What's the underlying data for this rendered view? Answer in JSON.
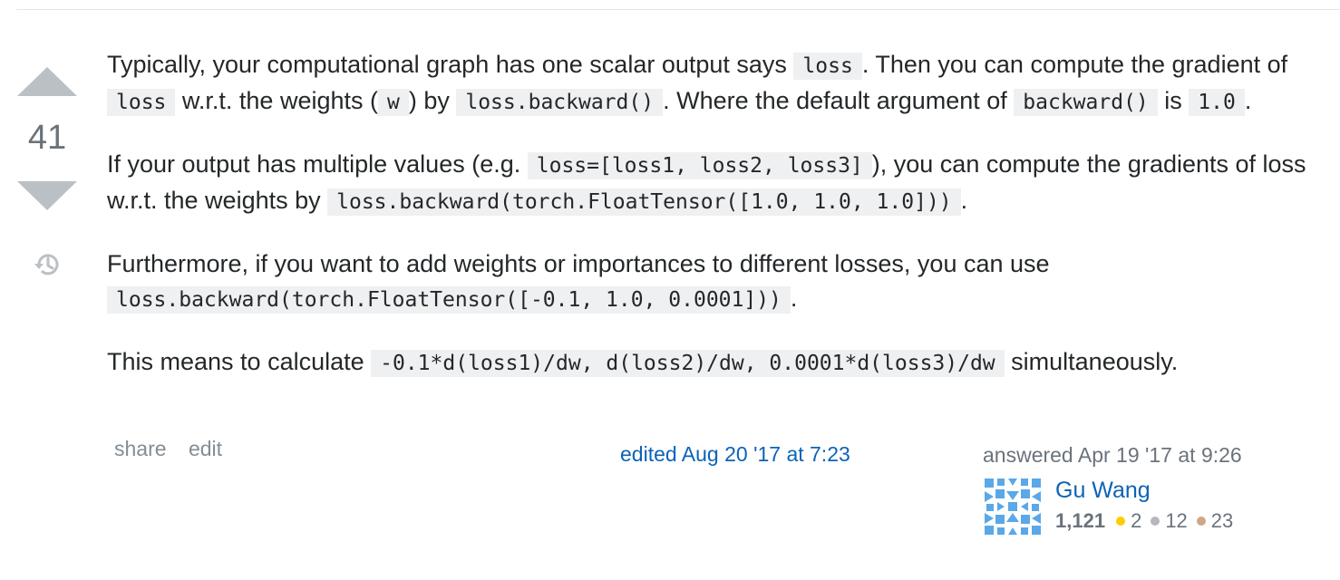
{
  "vote": {
    "count": "41"
  },
  "post": {
    "p1": {
      "t1": "Typically, your computational graph has one scalar output says ",
      "c1": "loss",
      "t2": ". Then you can compute the gradient of ",
      "c2": "loss",
      "t3": " w.r.t. the weights (",
      "c3": "w",
      "t4": ") by ",
      "c4": "loss.backward()",
      "t5": ". Where the default argument of ",
      "c5": "backward()",
      "t6": " is ",
      "c6": "1.0",
      "t7": "."
    },
    "p2": {
      "t1": "If your output has multiple values (e.g. ",
      "c1": "loss=[loss1, loss2, loss3]",
      "t2": "), you can compute the gradients of loss w.r.t. the weights by ",
      "c2": "loss.backward(torch.FloatTensor([1.0, 1.0, 1.0]))",
      "t3": "."
    },
    "p3": {
      "t1": "Furthermore, if you want to add weights or importances to different losses, you can use ",
      "c1": "loss.backward(torch.FloatTensor([-0.1, 1.0, 0.0001]))",
      "t2": "."
    },
    "p4": {
      "t1": "This means to calculate ",
      "c1": "-0.1*d(loss1)/dw, d(loss2)/dw, 0.0001*d(loss3)/dw",
      "t2": " simultaneously."
    }
  },
  "menu": {
    "share": "share",
    "edit": "edit"
  },
  "edited": "edited Aug 20 '17 at 7:23",
  "user": {
    "answered": "answered Apr 19 '17 at 9:26",
    "name": "Gu Wang",
    "reputation": "1,121",
    "badges": [
      {
        "count": "2",
        "color": "#ffcc01"
      },
      {
        "count": "12",
        "color": "#b4b8bc"
      },
      {
        "count": "23",
        "color": "#d1a684"
      }
    ]
  },
  "colors": {
    "link": "#0c63b6",
    "vote_arrow": "#bbc0c4",
    "code_bg": "#eff0f1",
    "avatar": "#5aa8e8"
  },
  "icons": {
    "upvote": "triangle-up-icon",
    "downvote": "triangle-down-icon",
    "history": "history-icon",
    "avatar": "identicon"
  }
}
